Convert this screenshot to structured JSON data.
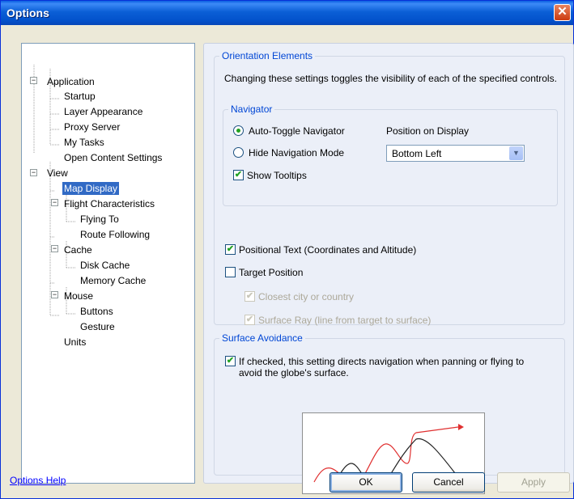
{
  "window": {
    "title": "Options",
    "close_glyph": "✕"
  },
  "tree": {
    "nodes": [
      {
        "label": "Application",
        "expander": "−"
      },
      {
        "label": "Startup"
      },
      {
        "label": "Layer Appearance"
      },
      {
        "label": "Proxy Server"
      },
      {
        "label": "My Tasks"
      },
      {
        "label": "Open Content Settings"
      },
      {
        "label": "View",
        "expander": "−"
      },
      {
        "label": "Map Display",
        "selected": true
      },
      {
        "label": "Flight Characteristics",
        "expander": "−"
      },
      {
        "label": "Flying To"
      },
      {
        "label": "Route Following"
      },
      {
        "label": "Cache",
        "expander": "−"
      },
      {
        "label": "Disk Cache"
      },
      {
        "label": "Memory Cache"
      },
      {
        "label": "Mouse",
        "expander": "−"
      },
      {
        "label": "Buttons"
      },
      {
        "label": "Gesture"
      },
      {
        "label": "Units"
      }
    ]
  },
  "orientation": {
    "legend": "Orientation Elements",
    "description": "Changing these settings toggles the visibility of each of the specified controls.",
    "navigator": {
      "legend": "Navigator",
      "auto_toggle_label": "Auto-Toggle Navigator",
      "auto_toggle_selected": true,
      "hide_mode_label": "Hide Navigation Mode",
      "hide_mode_selected": false,
      "position_label": "Position on Display",
      "position_value": "Bottom Left",
      "show_tooltips_label": "Show Tooltips",
      "show_tooltips_checked": true
    },
    "positional_text_label": "Positional Text (Coordinates and Altitude)",
    "positional_text_checked": true,
    "target_position_label": "Target Position",
    "target_position_checked": false,
    "closest_city_label": "Closest city or country",
    "closest_city_checked": true,
    "surface_ray_label": "Surface Ray (line from target to surface)",
    "surface_ray_checked": true
  },
  "surface": {
    "legend": "Surface Avoidance",
    "description": "If checked, this setting directs navigation when panning or flying to avoid the globe's surface.",
    "checked": true
  },
  "footer": {
    "help_link": "Options Help",
    "ok_label": "OK",
    "cancel_label": "Cancel",
    "apply_label": "Apply"
  },
  "colors": {
    "title_bar": "#0a5fe0",
    "selection": "#316ac5",
    "legend_text": "#0046d5",
    "check_mark": "#21a121",
    "red_path": "#e03030"
  },
  "icons": {
    "checked_glyph": "✔",
    "dropdown_glyph": "▼"
  }
}
